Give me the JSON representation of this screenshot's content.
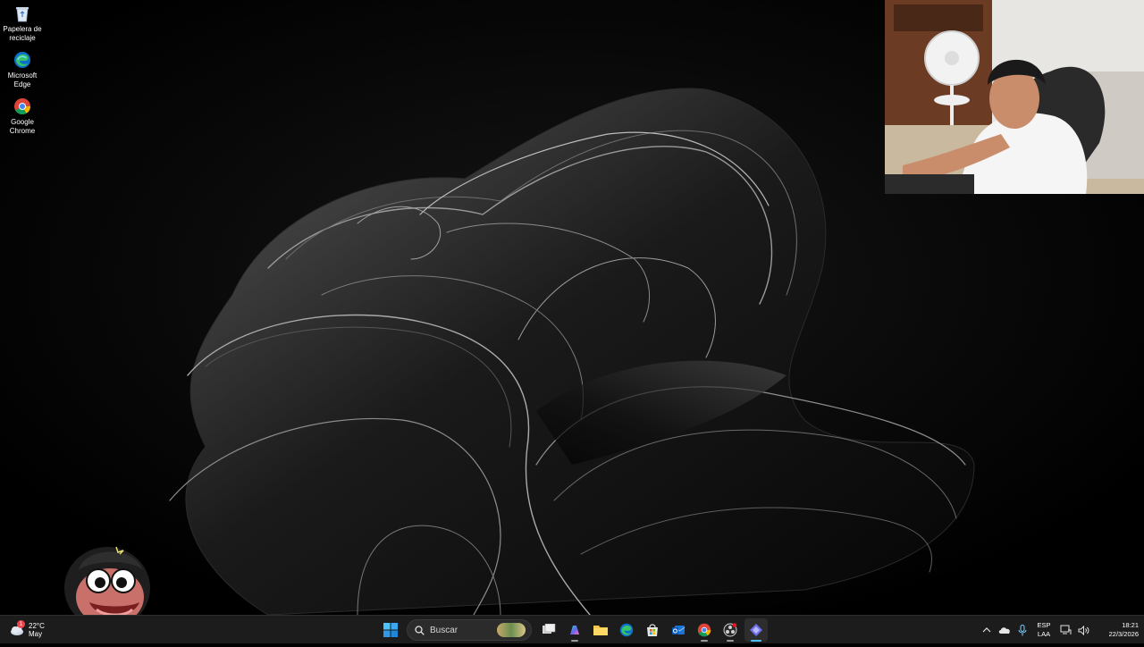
{
  "desktop": {
    "icons": [
      {
        "label": "Papelera de reciclaje",
        "icon": "recycle-bin-icon"
      },
      {
        "label": "Microsoft Edge",
        "icon": "edge-icon"
      },
      {
        "label": "Google Chrome",
        "icon": "chrome-icon"
      }
    ]
  },
  "taskbar": {
    "weather": {
      "temp": "22°C",
      "subtitle": "May",
      "badge": "1"
    },
    "search_label": "Buscar",
    "apps": [
      "start-icon",
      "search-icon",
      "task-view-icon",
      "copilot-icon",
      "file-explorer-icon",
      "edge-icon",
      "store-icon",
      "outlook-icon",
      "chrome-icon",
      "obs-icon",
      "app-icon"
    ],
    "language": {
      "line1": "ESP",
      "line2": "LAA"
    },
    "time": "18:21",
    "date": "22/3/2026"
  },
  "colors": {
    "taskbar_bg": "#1c1c1c",
    "accent": "#4cc2ff",
    "desktop_bg": "#000000"
  }
}
